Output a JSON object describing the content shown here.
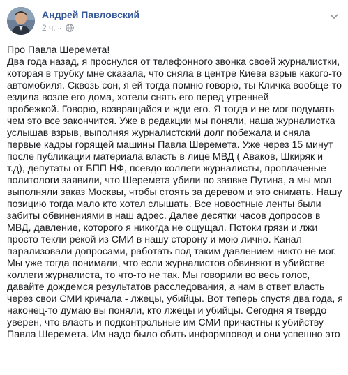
{
  "post": {
    "author": "Андрей Павловский",
    "time": "2 ч.",
    "separator": "·",
    "audience_icon": "globe-icon",
    "menu_icon": "chevron-down-icon",
    "title": "Про Павла Шеремета!",
    "body_lines": [
      "Два года назад, я проснулся от телефонного звонка своей журналистки,",
      "которая в трубку мне сказала, что сняла в центре Киева взрыв какого-то",
      "автомобиля. Сквозь сон, я ей тогда помню говорю, ты Кличка вообще-то",
      "ездила возле его дома, хотели снять его перед утренней",
      "пробежкой. Говорю, возвращайся и жди его. Я тогда и не мог подумать",
      "чем это все закончится. Уже в редакции мы поняли, наша журналистка",
      "услышав взрыв, выполняя журналистский долг побежала и сняла",
      "первые кадры горящей машины Павла Шеремета. Уже через 15 минут",
      "после публикации материала власть в лице МВД ( Аваков, Шкиряк и",
      "т.д), депутаты от БПП НФ, псевдо коллеги журналисты, проплаченые",
      "политологи заявили, что Шеремета убили по заявке Путина, а мы мол",
      "выполняли заказ Москвы, чтобы стоять за деревом и это снимать. Нашу",
      "позицию тогда мало кто хотел слышать. Все новостные ленты были",
      "забиты обвинениями в наш адрес. Далее десятки часов допросов в",
      "МВД, давление, которого я никогда не ощущал. Потоки грязи и лжи",
      "просто текли рекой из СМИ в нашу сторону и мою лично. Канал",
      "парализовали допросами, работать под таким давлением никто не мог.",
      "Мы уже тогда понимали, что если журналистов обвиняют в убийстве",
      "коллеги журналиста, то что-то не так. Мы говорили во весь голос,",
      "давайте дождемся результатов расследования, а нам в ответ власть",
      "через свои СМИ кричала - лжецы, убийцы. Вот теперь спустя два года, я",
      "наконец-то думаю вы поняли, кто лжецы и убийцы. Сегодня я твердо",
      "уверен, что власть и подконтрольные им СМИ причастны к убийству",
      "Павла Шеремета. Им надо было сбить информповод и они успешно это"
    ]
  },
  "colors": {
    "author": "#365899",
    "meta": "#90949c",
    "text": "#1c1e21"
  }
}
